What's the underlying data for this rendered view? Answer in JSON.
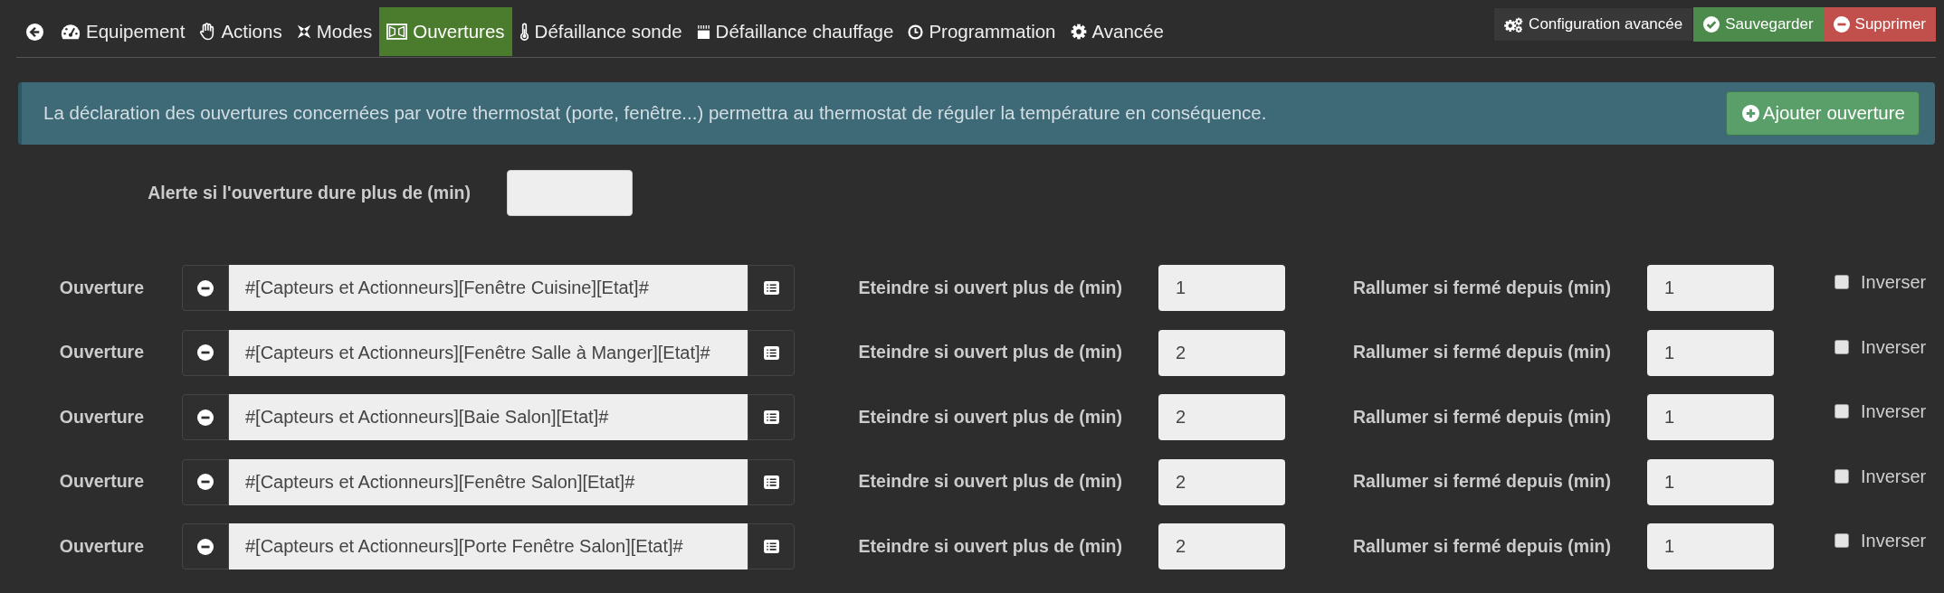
{
  "tabs": [
    {
      "label": "Equipement",
      "selected": false
    },
    {
      "label": "Actions",
      "selected": false
    },
    {
      "label": "Modes",
      "selected": false
    },
    {
      "label": "Ouvertures",
      "selected": true
    },
    {
      "label": "Défaillance sonde",
      "selected": false
    },
    {
      "label": "Défaillance chauffage",
      "selected": false
    },
    {
      "label": "Programmation",
      "selected": false
    },
    {
      "label": "Avancée",
      "selected": false
    }
  ],
  "toolbar": {
    "buttons": [
      {
        "label": "Configuration avancée",
        "kind": "neutral"
      },
      {
        "label": "Sauvegarder",
        "kind": "save"
      },
      {
        "label": "Supprimer",
        "kind": "delete"
      }
    ]
  },
  "info_banner": {
    "text": "La déclaration des ouvertures concernées par votre thermostat (porte, fenêtre...) permettra au thermostat de réguler la température en conséquence.",
    "button": "Ajouter ouverture"
  },
  "alert_setting": {
    "label": "Alerte si l'ouverture dure plus de (min)"
  },
  "openings": [
    {
      "label": "Ouverture",
      "command": "#[Capteurs et Actionneurs][Fenêtre Cuisine][Etat]#",
      "off_delay_label": "Eteindre si ouvert plus de (min)",
      "off_delay": "1",
      "on_delay_label": "Rallumer si fermé depuis (min)",
      "on_delay": "1",
      "invert_label": "Inverser",
      "invert_checked": false
    },
    {
      "label": "Ouverture",
      "command": "#[Capteurs et Actionneurs][Fenêtre Salle à Manger][Etat]#",
      "off_delay_label": "Eteindre si ouvert plus de (min)",
      "off_delay": "2",
      "on_delay_label": "Rallumer si fermé depuis (min)",
      "on_delay": "1",
      "invert_label": "Inverser",
      "invert_checked": false
    },
    {
      "label": "Ouverture",
      "command": "#[Capteurs et Actionneurs][Baie Salon][Etat]#",
      "off_delay_label": "Eteindre si ouvert plus de (min)",
      "off_delay": "2",
      "on_delay_label": "Rallumer si fermé depuis (min)",
      "on_delay": "1",
      "invert_label": "Inverser",
      "invert_checked": false
    },
    {
      "label": "Ouverture",
      "command": "#[Capteurs et Actionneurs][Fenêtre Salon][Etat]#",
      "off_delay_label": "Eteindre si ouvert plus de (min)",
      "off_delay": "2",
      "on_delay_label": "Rallumer si fermé depuis (min)",
      "on_delay": "1",
      "invert_label": "Inverser",
      "invert_checked": false
    },
    {
      "label": "Ouverture",
      "command": "#[Capteurs et Actionneurs][Porte Fenêtre Salon][Etat]#",
      "off_delay_label": "Eteindre si ouvert plus de (min)",
      "off_delay": "2",
      "on_delay_label": "Rallumer si fermé depuis (min)",
      "on_delay": "1",
      "invert_label": "Inverser",
      "invert_checked": false
    }
  ]
}
